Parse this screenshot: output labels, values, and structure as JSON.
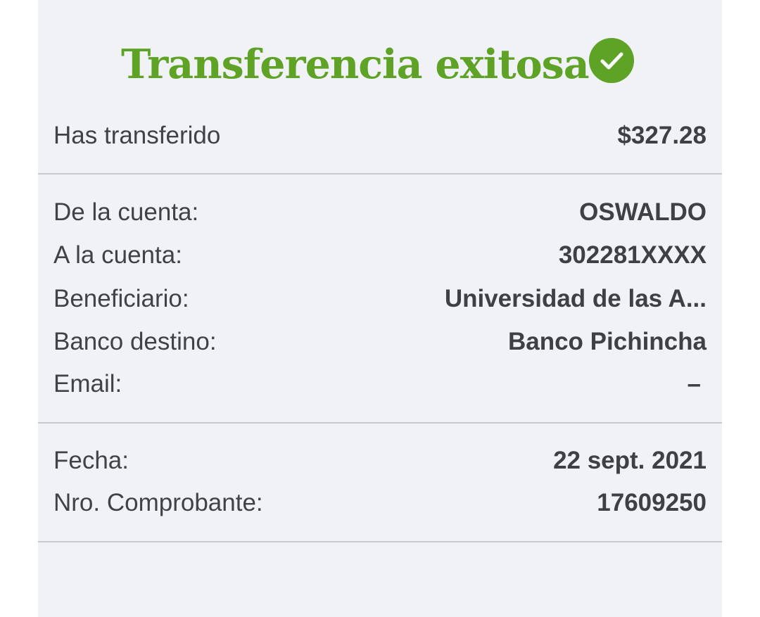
{
  "header": {
    "title": "Transferencia exitosa",
    "title_color": "#5ea326",
    "check_icon": "check-circle-icon",
    "check_color": "#5ea326"
  },
  "amount": {
    "label": "Has transferido",
    "value": "$327.28"
  },
  "details": {
    "from_label": "De la cuenta:",
    "from_value": "OSWALDO",
    "to_label": "A la cuenta:",
    "to_value": "302281XXXX",
    "beneficiary_label": "Beneficiario:",
    "beneficiary_value": "Universidad de las A...",
    "bank_label": "Banco destino:",
    "bank_value": "Banco Pichincha",
    "email_label": "Email:",
    "email_value": "–"
  },
  "meta": {
    "date_label": "Fecha:",
    "date_value": "22 sept. 2021",
    "voucher_label": "Nro. Comprobante:",
    "voucher_value": "17609250"
  },
  "colors": {
    "card_background": "#f1f2f6",
    "text": "#3f4247",
    "divider": "#c8cace",
    "success": "#5ea326"
  }
}
